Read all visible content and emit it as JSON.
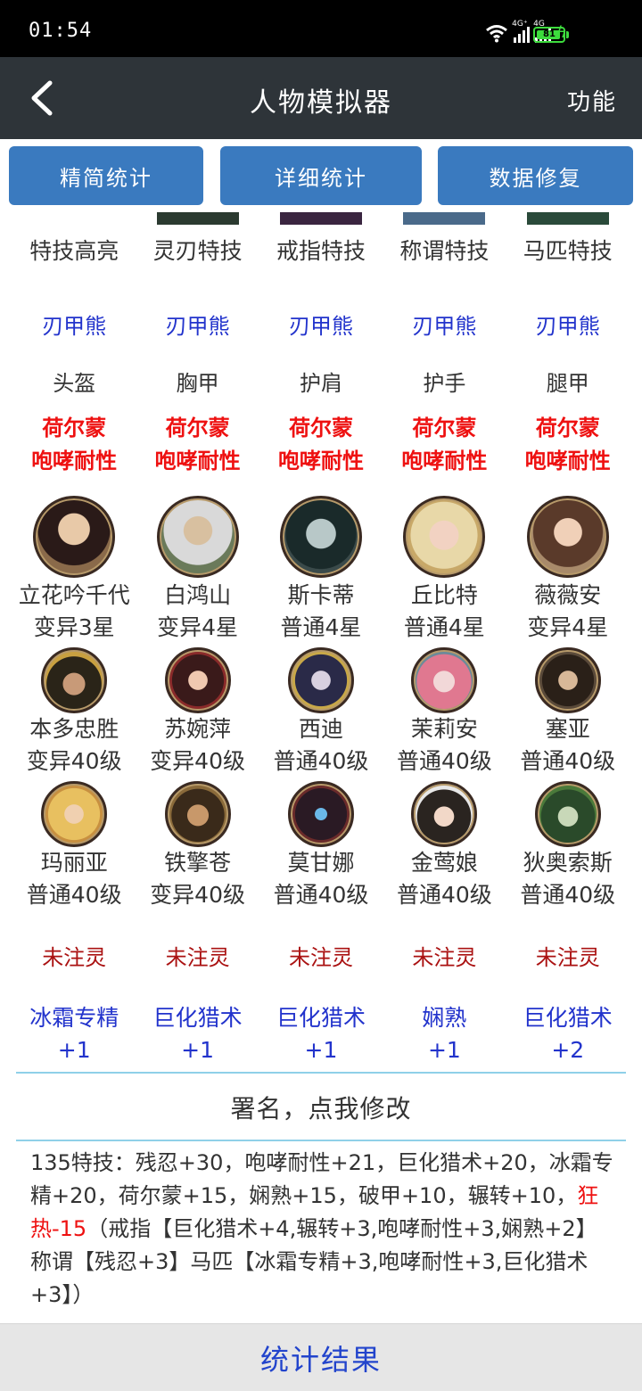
{
  "status": {
    "time": "01:54",
    "net1": "4G⁺",
    "net2": "4G",
    "battery": "81",
    "battery_level": 0.81
  },
  "header": {
    "title": "人物模拟器",
    "func_label": "功能",
    "back_icon": "chevron-left-icon"
  },
  "buttons": {
    "simple": "精简统计",
    "detail": "详细统计",
    "repair": "数据修复"
  },
  "special_slots": [
    "特技高亮",
    "灵刃特技",
    "戒指特技",
    "称谓特技",
    "马匹特技"
  ],
  "set_names": [
    "刃甲熊",
    "刃甲熊",
    "刃甲熊",
    "刃甲熊",
    "刃甲熊"
  ],
  "armor_slots": [
    "头盔",
    "胸甲",
    "护肩",
    "护手",
    "腿甲"
  ],
  "armor_traits": [
    {
      "line1": "荷尔蒙",
      "line2": "咆哮耐性"
    },
    {
      "line1": "荷尔蒙",
      "line2": "咆哮耐性"
    },
    {
      "line1": "荷尔蒙",
      "line2": "咆哮耐性"
    },
    {
      "line1": "荷尔蒙",
      "line2": "咆哮耐性"
    },
    {
      "line1": "荷尔蒙",
      "line2": "咆哮耐性"
    }
  ],
  "main_heroes": [
    {
      "name": "立花吟千代",
      "level": "变异3星"
    },
    {
      "name": "白鸿山",
      "level": "变异4星"
    },
    {
      "name": "斯卡蒂",
      "level": "普通4星"
    },
    {
      "name": "丘比特",
      "level": "普通4星"
    },
    {
      "name": "薇薇安",
      "level": "变异4星"
    }
  ],
  "heroes_row2": [
    {
      "name": "本多忠胜",
      "level": "变异40级"
    },
    {
      "name": "苏婉萍",
      "level": "变异40级"
    },
    {
      "name": "西迪",
      "level": "普通40级"
    },
    {
      "name": "茉莉安",
      "level": "普通40级"
    },
    {
      "name": "塞亚",
      "level": "普通40级"
    }
  ],
  "heroes_row3": [
    {
      "name": "玛丽亚",
      "level": "普通40级"
    },
    {
      "name": "铁擎苍",
      "level": "变异40级"
    },
    {
      "name": "莫甘娜",
      "level": "普通40级"
    },
    {
      "name": "金莺娘",
      "level": "普通40级"
    },
    {
      "name": "狄奥索斯",
      "level": "普通40级"
    }
  ],
  "soul_status": [
    "未注灵",
    "未注灵",
    "未注灵",
    "未注灵",
    "未注灵"
  ],
  "pet_skills": [
    {
      "name": "冰霜专精",
      "value": "+1"
    },
    {
      "name": "巨化猎术",
      "value": "+1"
    },
    {
      "name": "巨化猎术",
      "value": "+1"
    },
    {
      "name": "娴熟",
      "value": "+1"
    },
    {
      "name": "巨化猎术",
      "value": "+2"
    }
  ],
  "signature": "署名，点我修改",
  "summary": {
    "part1": "135特技：残忍+30，咆哮耐性+21，巨化猎术+20，冰霜专精+20，荷尔蒙+15，娴熟+15，破甲+10，辗转+10，",
    "highlight": "狂热-15",
    "part2": "（戒指【巨化猎术+4,辗转+3,咆哮耐性+3,娴熟+2】称谓【残忍+3】马匹【冰霜专精+3,咆哮耐性+3,巨化猎术+3】）"
  },
  "bottom": {
    "label": "统计结果"
  },
  "colors": {
    "header_bg": "#2e3439",
    "button_bg": "#3a7abf",
    "blue_text": "#2233cc",
    "red_text": "#ee1111",
    "soul_text": "#aa1111"
  }
}
